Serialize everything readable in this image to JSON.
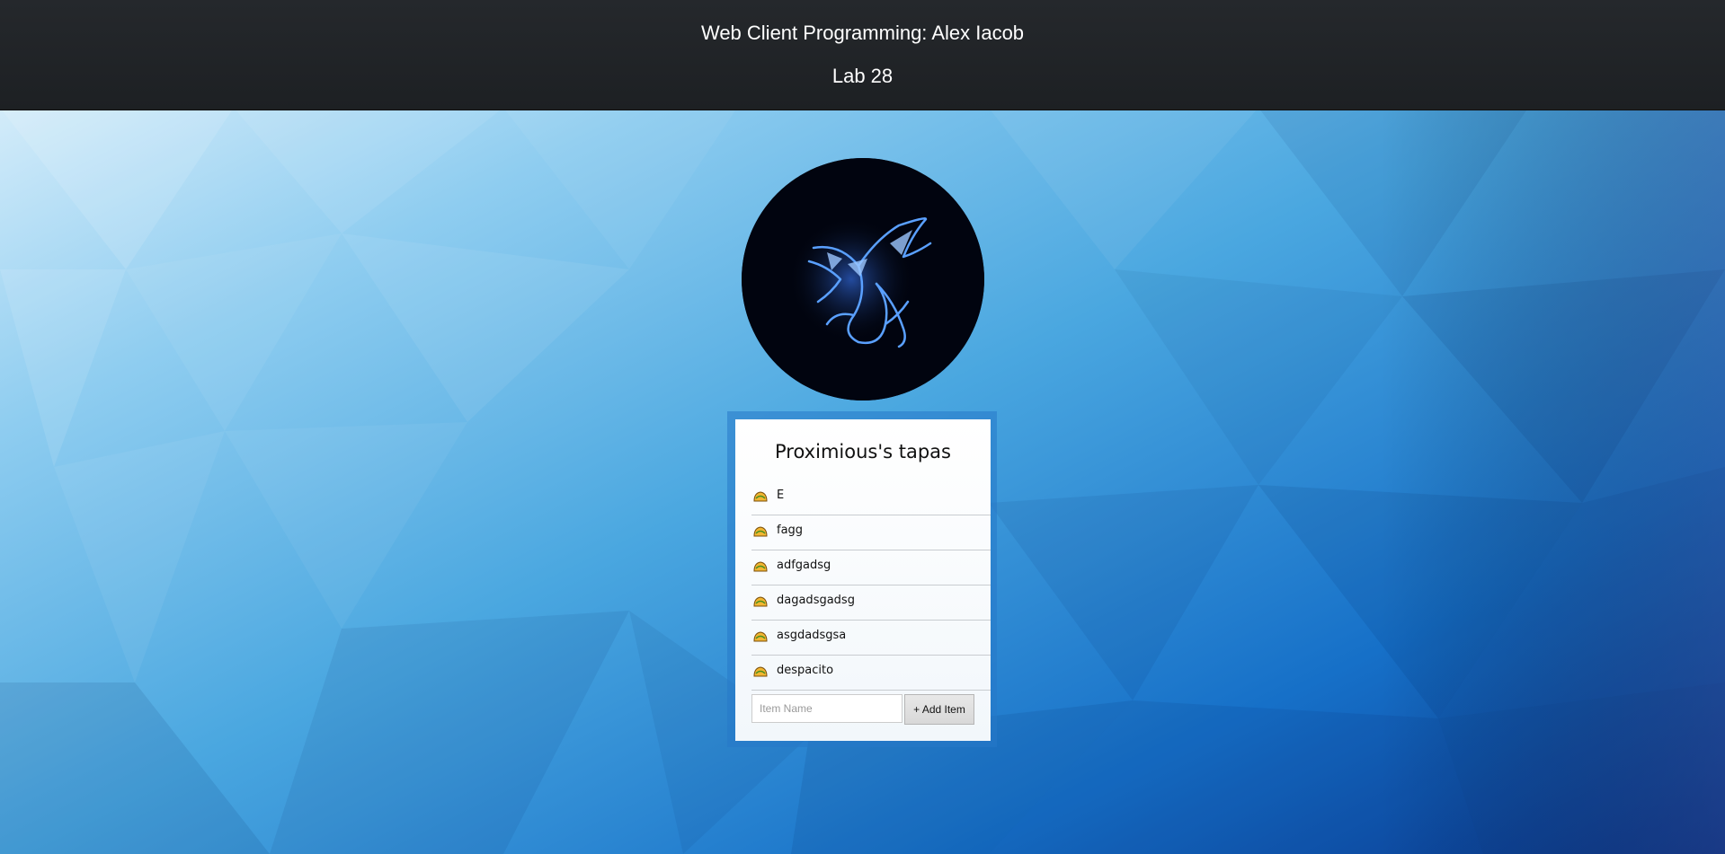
{
  "header": {
    "title": "Web Client Programming: Alex Iacob",
    "subtitle": "Lab 28"
  },
  "avatar": {
    "icon": "blue-dragon-icon"
  },
  "card": {
    "title": "Proximious's tapas",
    "items": [
      {
        "label": "E",
        "icon": "taco-icon"
      },
      {
        "label": "fagg",
        "icon": "taco-icon"
      },
      {
        "label": "adfgadsg",
        "icon": "taco-icon"
      },
      {
        "label": "dagadsgadsg",
        "icon": "taco-icon"
      },
      {
        "label": "asgdadsgsa",
        "icon": "taco-icon"
      },
      {
        "label": "despacito",
        "icon": "taco-icon"
      }
    ],
    "input": {
      "value": "",
      "placeholder": "Item Name"
    },
    "add_button_label": "+ Add Item"
  },
  "colors": {
    "header_bg": "#1f2226",
    "background_light": "#cfe6f8",
    "background_dark": "#0d3a8c"
  }
}
